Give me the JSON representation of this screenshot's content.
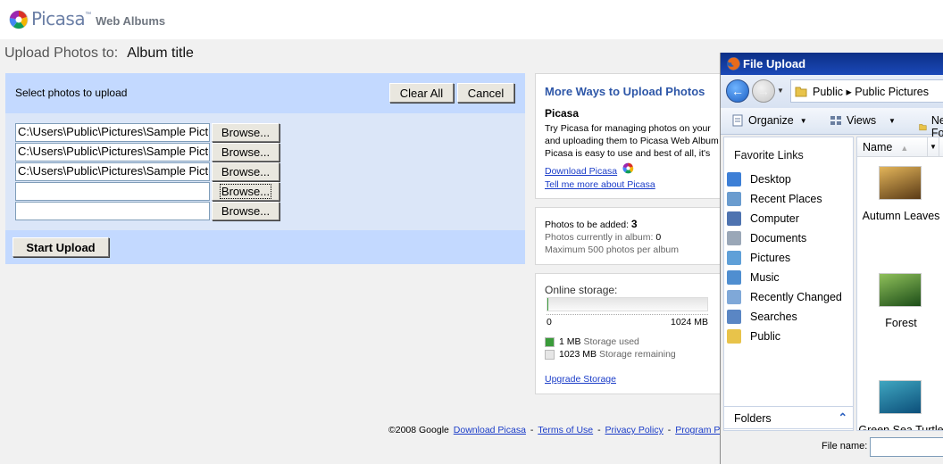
{
  "header": {
    "brand": "Picasa",
    "tm": "™",
    "subtitle": "Web Albums"
  },
  "upload_title": {
    "label": "Upload Photos to:",
    "album": "Album title"
  },
  "panel": {
    "select_label": "Select photos to upload",
    "clear_all": "Clear All",
    "cancel": "Cancel",
    "rows": [
      {
        "value": "C:\\Users\\Public\\Pictures\\Sample Pictures\\Autumn Leaves.jpg",
        "browse": "Browse..."
      },
      {
        "value": "C:\\Users\\Public\\Pictures\\Sample Pictures\\Forest.jpg",
        "browse": "Browse..."
      },
      {
        "value": "C:\\Users\\Public\\Pictures\\Sample Pictures\\Green Sea Turtle.jpg",
        "browse": "Browse..."
      },
      {
        "value": "",
        "browse": "Browse..."
      },
      {
        "value": "",
        "browse": "Browse..."
      }
    ],
    "start_upload": "Start Upload"
  },
  "more_ways": {
    "heading": "More Ways to Upload Photos",
    "product": "Picasa",
    "text_lines": [
      "Try Picasa for managing photos on your",
      "and uploading them to Picasa Web Album",
      "Picasa is easy to use and best of all, it's"
    ],
    "download": "Download Picasa",
    "tell_more": "Tell me more about Picasa"
  },
  "photos": {
    "to_add_label": "Photos to be added:",
    "to_add_value": "3",
    "current_label": "Photos currently in album:",
    "current_value": "0",
    "max_label": "Maximum 500 photos per album"
  },
  "storage": {
    "heading": "Online storage:",
    "used_fraction": 0.001,
    "min_label": "0",
    "max_label": "1024 MB",
    "used_value": "1 MB",
    "used_label": "Storage used",
    "remaining_value": "1023 MB",
    "remaining_label": "Storage remaining",
    "upgrade": "Upgrade Storage",
    "used_color": "#3a9b3a",
    "remaining_color": "#e6e6e6"
  },
  "footer": {
    "copyright": "©2008 Google",
    "links": [
      "Download Picasa",
      "Terms of Use",
      "Privacy Policy",
      "Program Policies"
    ],
    "sep": "-"
  },
  "dialog": {
    "title": "File Upload",
    "crumb": "Public ▸ Public Pictures",
    "toolbar": {
      "organize": "Organize",
      "views": "Views",
      "new_folder": "New Folder"
    },
    "favorite_links_label": "Favorite Links",
    "links": [
      {
        "label": "Desktop",
        "icon": "desktop-icon",
        "color": "#3d7fd6"
      },
      {
        "label": "Recent Places",
        "icon": "recent-places-icon",
        "color": "#6a9ccf"
      },
      {
        "label": "Computer",
        "icon": "computer-icon",
        "color": "#4e73b0"
      },
      {
        "label": "Documents",
        "icon": "documents-icon",
        "color": "#9aa7b7"
      },
      {
        "label": "Pictures",
        "icon": "pictures-icon",
        "color": "#5fa0d8"
      },
      {
        "label": "Music",
        "icon": "music-icon",
        "color": "#4f8ed0"
      },
      {
        "label": "Recently Changed",
        "icon": "recently-changed-icon",
        "color": "#7fa8d8"
      },
      {
        "label": "Searches",
        "icon": "searches-icon",
        "color": "#5a86c4"
      },
      {
        "label": "Public",
        "icon": "public-folder-icon",
        "color": "#e8c34a"
      }
    ],
    "folders_label": "Folders",
    "column_name": "Name",
    "files": [
      {
        "name": "Autumn Leaves",
        "c1": "#5a3a16",
        "c2": "#e3b55a"
      },
      {
        "name": "Forest",
        "c1": "#1c4d18",
        "c2": "#8fc05a"
      },
      {
        "name": "Green Sea Turtle",
        "c1": "#0c4f7a",
        "c2": "#3fa6c0"
      }
    ],
    "file_name_label": "File name:"
  }
}
